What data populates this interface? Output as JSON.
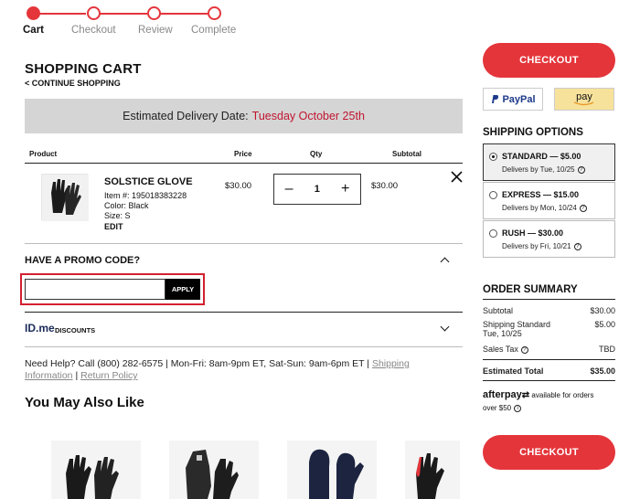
{
  "steps": [
    {
      "label": "Cart",
      "active": true
    },
    {
      "label": "Checkout",
      "active": false
    },
    {
      "label": "Review",
      "active": false
    },
    {
      "label": "Complete",
      "active": false
    }
  ],
  "cart": {
    "title": "SHOPPING CART",
    "continue": "< CONTINUE SHOPPING",
    "delivery_label": "Estimated Delivery Date:",
    "delivery_date": "Tuesday October 25th",
    "columns": {
      "product": "Product",
      "price": "Price",
      "qty": "Qty",
      "subtotal": "Subtotal"
    },
    "item": {
      "name": "SOLSTICE GLOVE",
      "item_no": "Item #: 195018383228",
      "color": "Color: Black",
      "size": "Size: S",
      "edit": "EDIT",
      "price": "$30.00",
      "qty": "1",
      "subtotal": "$30.00",
      "remove_icon": "close-icon"
    }
  },
  "promo": {
    "title": "HAVE A PROMO CODE?",
    "value": "",
    "apply": "APPLY"
  },
  "idme": {
    "logo": "ID.me",
    "label": "DISCOUNTS"
  },
  "help": {
    "text": "Need Help? Call (800) 282-6575 | Mon-Fri: 8am-9pm ET, Sat-Sun: 9am-6pm ET |",
    "shipping_link": "Shipping Information",
    "sep": "|",
    "return_link": "Return Policy"
  },
  "also_like": "You May Also Like",
  "sidebar": {
    "checkout": "CHECKOUT",
    "paypal": "PayPal",
    "amazon": "pay",
    "shipping_title": "SHIPPING OPTIONS",
    "options": [
      {
        "name": "STANDARD — $5.00",
        "sub": "Delivers by Tue, 10/25",
        "selected": true
      },
      {
        "name": "EXPRESS — $15.00",
        "sub": "Delivers by Mon, 10/24",
        "selected": false
      },
      {
        "name": "RUSH — $30.00",
        "sub": "Delivers by Fri, 10/21",
        "selected": false
      }
    ],
    "summary_title": "ORDER SUMMARY",
    "summary": {
      "subtotal_label": "Subtotal",
      "subtotal": "$30.00",
      "shipping_label": "Shipping Standard",
      "shipping_date": "Tue, 10/25",
      "shipping": "$5.00",
      "tax_label": "Sales Tax",
      "tax": "TBD",
      "total_label": "Estimated Total",
      "total": "$35.00"
    },
    "afterpay_logo": "afterpay",
    "afterpay_text": "available for orders",
    "afterpay_min": "over $50"
  },
  "colors": {
    "brand_red": "#e4353b",
    "date_red": "#c0152f"
  }
}
